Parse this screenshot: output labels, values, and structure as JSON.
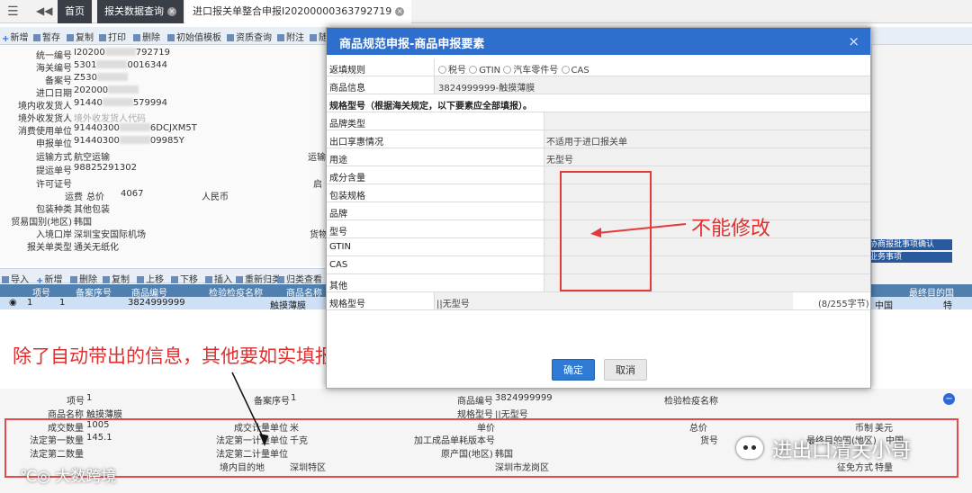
{
  "tabs": {
    "home": "首页",
    "query": "报关数据查询",
    "active": "进口报关单整合申报I20200000363792719"
  },
  "toolbar": {
    "add": "新增",
    "save": "暂存",
    "copy": "复制",
    "print": "打印",
    "delete": "删除",
    "template": "初始值模板",
    "query": "资质查询",
    "attach": "附注",
    "more": "随"
  },
  "form": {
    "uid_label": "统一编号",
    "uid_value": "I20200",
    "uid_tail": "792719",
    "customs_no_label": "海关编号",
    "customs_no_value": "5301",
    "customs_no_tail": "0016344",
    "record_label": "备案号",
    "record_value": "Z530",
    "import_date_label": "进口日期",
    "import_date_value": "202000",
    "consignee_label": "境内收发货人",
    "consignee_value": "91440",
    "consignee_tail": "579994",
    "foreign_label": "境外收发货人",
    "foreign_placeholder": "境外收发货人代码",
    "user_label": "消费使用单位",
    "user_value": "91440300",
    "user_tail": "6DCJXM5T",
    "declarant_label": "申报单位",
    "declarant_value": "91440300",
    "declarant_tail": "09985Y",
    "transport_label": "运输方式",
    "transport_value": "航空运输",
    "transport_right": "运输",
    "bill_label": "提运单号",
    "bill_value": "98825291302",
    "license_label": "许可证号",
    "license_right": "启",
    "freight_label": "运费",
    "freight_type": "总价",
    "freight_value": "4067",
    "freight_currency": "人民币",
    "pack_label": "包装种类",
    "pack_value": "其他包装",
    "trade_country_label": "贸易国别(地区)",
    "trade_country_value": "韩国",
    "entry_port_label": "入境口岸",
    "entry_port_value": "深圳宝安国际机场",
    "entry_port_right": "货物",
    "decl_type_label": "报关单类型",
    "decl_type_value": "通关无纸化"
  },
  "grid_toolbar": {
    "import": "导入",
    "add": "新增",
    "delete": "删除",
    "copy": "复制",
    "up": "上移",
    "down": "下移",
    "insert": "插入",
    "reclass": "重新归类",
    "classify_query": "归类查看"
  },
  "grid": {
    "headers": [
      "项号",
      "备案序号",
      "商品编号",
      "检验检疫名称",
      "商品名称"
    ],
    "row": [
      "1",
      "1",
      "3824999999",
      "",
      "触摸薄膜"
    ]
  },
  "right_panel": {
    "btn1": "协商报批事项确认",
    "btn2": "业务事项",
    "grid_header": "最终目的国",
    "grid_value": "中国",
    "grid_tail": "特",
    "scroll_label": "tip"
  },
  "modal": {
    "title": "商品规范申报-商品申报要素",
    "close": "×",
    "rule_label": "返填规则",
    "rule_options": [
      "税号",
      "GTIN",
      "汽车零件号",
      "CAS"
    ],
    "product_info_label": "商品信息",
    "product_info_value": "3824999999-触摸薄膜",
    "spec_heading": "规格型号（根据海关规定，以下要素应全部填报）。",
    "fields": [
      {
        "label": "品牌类型",
        "value": ""
      },
      {
        "label": "出口享惠情况",
        "value": "不适用于进口报关单"
      },
      {
        "label": "用途",
        "value": "无型号"
      },
      {
        "label": "成分含量",
        "value": ""
      },
      {
        "label": "包装规格",
        "value": ""
      },
      {
        "label": "品牌",
        "value": ""
      },
      {
        "label": "型号",
        "value": ""
      },
      {
        "label": "GTIN",
        "value": ""
      },
      {
        "label": "CAS",
        "value": ""
      },
      {
        "label": "其他",
        "value": ""
      }
    ],
    "spec_model_label": "规格型号",
    "spec_model_value": "||无型号",
    "byte_count": "(8/255字节)",
    "ok": "确定",
    "cancel": "取消"
  },
  "annotations": {
    "cannot_modify": "不能修改",
    "instruction": "除了自动带出的信息，其他要如实填报完整"
  },
  "lower_form": {
    "item_no_label": "项号",
    "item_no_value": "1",
    "record_seq_label": "备案序号",
    "record_seq_value": "1",
    "goods_code_label": "商品编号",
    "goods_code_value": "3824999999",
    "inspection_name_label": "检验检疫名称",
    "goods_name_label": "商品名称",
    "goods_name_value": "触摸薄膜",
    "spec_label": "规格型号",
    "spec_value": "||无型号",
    "deal_qty_label": "成交数量",
    "deal_qty_value": "1005",
    "deal_unit_label": "成交计量单位",
    "deal_unit_value": "米",
    "unit_price_label": "单价",
    "total_price_label": "总价",
    "currency_label": "币制",
    "currency_value": "美元",
    "legal_qty1_label": "法定第一数量",
    "legal_qty1_value": "145.1",
    "legal_unit1_label": "法定第一计量单位",
    "legal_unit1_value": "千克",
    "version_label": "加工成品单耗版本号",
    "item_goods_label": "货号",
    "final_country_label": "最终目的国(地区)",
    "final_country_value": "中国",
    "legal_qty2_label": "法定第二数量",
    "legal_unit2_label": "法定第二计量单位",
    "origin_label": "原产国(地区)",
    "origin_value": "韩国",
    "dest_label": "境内目的地",
    "dest_value": "深圳特区",
    "dest_area_value": "深圳市龙岗区",
    "tax_label": "征免方式",
    "tax_value": "特量"
  },
  "watermark": "大数跨境",
  "wechat_name": "进出口清关小哥",
  "colors": {
    "modal_header": "#2e6fce",
    "annotation_red": "#e03030",
    "ok_button": "#2e7bd6",
    "tab_dark": "#3a3f47"
  }
}
